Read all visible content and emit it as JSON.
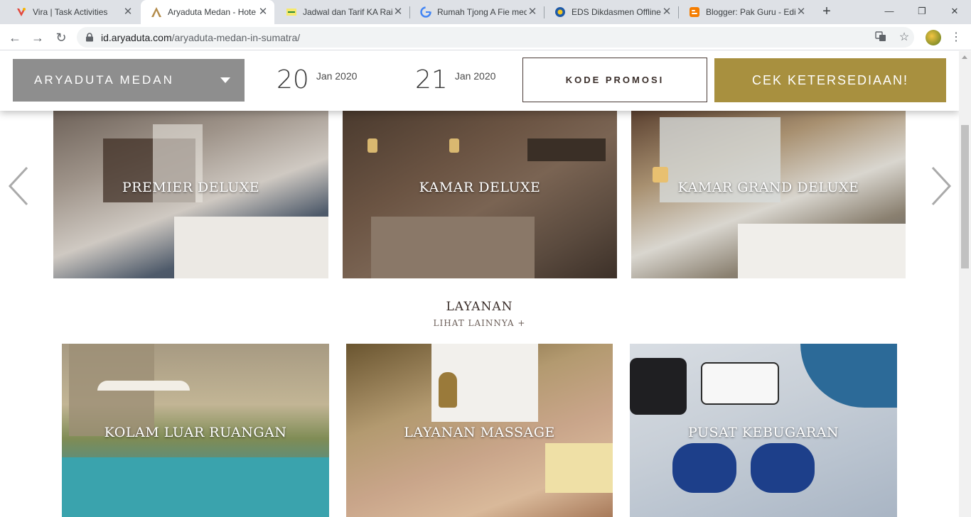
{
  "browser": {
    "tabs": [
      {
        "title": "Vira | Task Activities",
        "icon": "vira-icon"
      },
      {
        "title": "Aryaduta Medan - Hote",
        "icon": "aryaduta-icon"
      },
      {
        "title": "Jadwal dan Tarif KA Rail",
        "icon": "kai-icon"
      },
      {
        "title": "Rumah Tjong A Fie med",
        "icon": "google-icon"
      },
      {
        "title": "EDS Dikdasmen Offline",
        "icon": "kemdikbud-icon"
      },
      {
        "title": "Blogger: Pak Guru - Edi",
        "icon": "blogger-icon"
      }
    ],
    "url_host": "id.aryaduta.com",
    "url_path": "/aryaduta-medan-in-sumatra/"
  },
  "booking": {
    "hotel": "ARYADUTA MEDAN",
    "checkin_day": "20",
    "checkin_month": "Jan 2020",
    "checkout_day": "21",
    "checkout_month": "Jan 2020",
    "promo_label": "KODE PROMOSI",
    "cta_label": "CEK KETERSEDIAAN!"
  },
  "rooms": [
    {
      "label": "PREMIER DELUXE"
    },
    {
      "label": "KAMAR DELUXE"
    },
    {
      "label": "KAMAR GRAND DELUXE"
    }
  ],
  "services_section": {
    "title": "LAYANAN",
    "link": "LIHAT LAINNYA +"
  },
  "services": [
    {
      "label": "KOLAM LUAR RUANGAN"
    },
    {
      "label": "LAYANAN MASSAGE"
    },
    {
      "label": "PUSAT KEBUGARAN"
    }
  ],
  "colors": {
    "accent_gold": "#a8903f",
    "select_gray": "#8e8e8e"
  }
}
